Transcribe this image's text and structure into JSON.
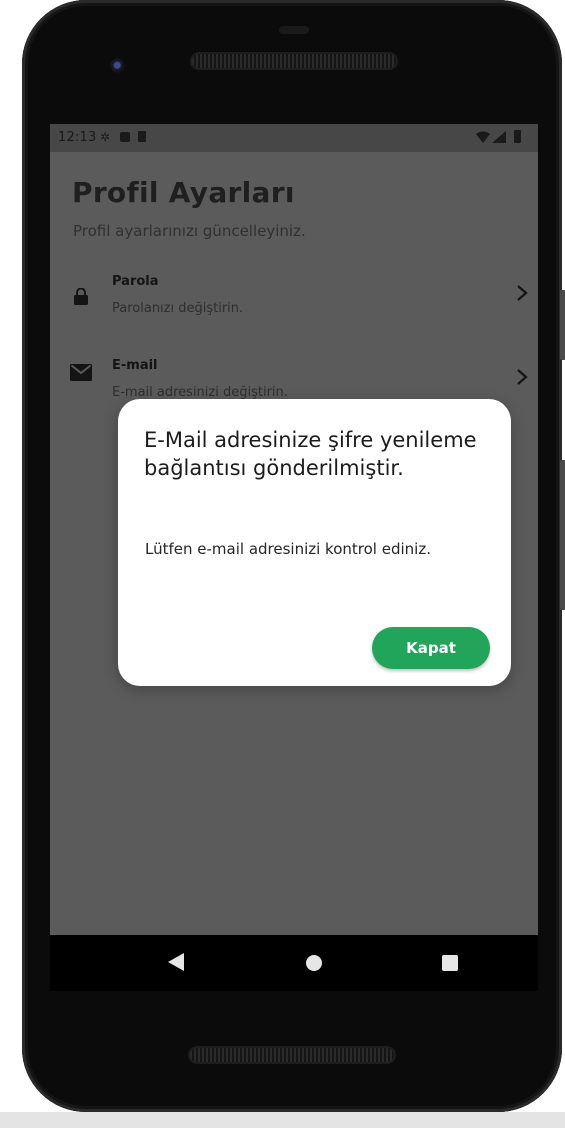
{
  "status_bar": {
    "time": "12:13",
    "icons": [
      "gear-icon",
      "notification-a-icon",
      "sd-card-icon",
      "wifi-icon",
      "signal-icon",
      "battery-icon"
    ]
  },
  "page": {
    "title": "Profil Ayarları",
    "subtitle": "Profil ayarlarınızı güncelleyiniz."
  },
  "settings": [
    {
      "title": "Parola",
      "description": "Parolanızı değiştirin.",
      "icon": "lock-icon"
    },
    {
      "title": "E-mail",
      "description": "E-mail adresinizi değiştirin.",
      "icon": "mail-icon"
    }
  ],
  "dialog": {
    "title": "E-Mail adresinize şifre yenileme bağlantısı gönderilmiştir.",
    "body": "Lütfen e-mail adresinizi kontrol ediniz.",
    "button_label": "Kapat"
  },
  "colors": {
    "accent": "#21a55b",
    "overlay_background": "#5b5b5b",
    "dialog_background": "#ffffff"
  },
  "nav_bar": {
    "icons": [
      "back-icon",
      "home-icon",
      "recents-icon"
    ]
  }
}
